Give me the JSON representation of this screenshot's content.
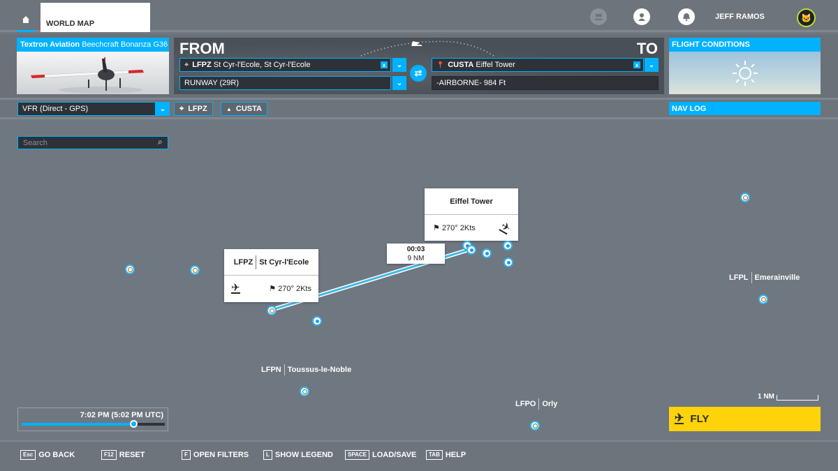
{
  "header": {
    "home_icon": "home-icon",
    "active_tab": "WORLD MAP",
    "icons": [
      "friends-icon",
      "profile-icon",
      "notifications-icon"
    ],
    "username": "JEFF RAMOS"
  },
  "aircraft": {
    "brand": "Textron Aviation",
    "model": "Beechcraft Bonanza G36"
  },
  "route": {
    "from_label": "FROM",
    "to_label": "TO",
    "from": {
      "icao": "LFPZ",
      "name": "St Cyr-l'Ecole, St Cyr-l'Ecole",
      "clear": "x"
    },
    "from_runway": "RUNWAY (29R)",
    "to": {
      "icao": "CUSTA",
      "name": "Eiffel Tower",
      "clear": "x"
    },
    "to_arrival": "-AIRBORNE- 984 Ft",
    "swap_icon": "swap-icon"
  },
  "conditions": {
    "title": "FLIGHT CONDITIONS",
    "weather_icon": "sun-icon"
  },
  "flight_plan": {
    "type": "VFR (Direct - GPS)",
    "departure_chip": "LFPZ",
    "arrival_chip": "CUSTA"
  },
  "nav_log": {
    "label": "NAV LOG"
  },
  "search": {
    "placeholder": "Search"
  },
  "map": {
    "departure_callout": {
      "icao": "LFPZ",
      "name": "St Cyr-l'Ecole",
      "wind": "270° 2Kts"
    },
    "arrival_callout": {
      "name": "Eiffel Tower",
      "wind": "270° 2Kts"
    },
    "leg": {
      "time": "00:03",
      "distance": "9 NM"
    },
    "airports": [
      {
        "icao": "LFPL",
        "name": "Emerainville"
      },
      {
        "icao": "LFPN",
        "name": "Toussus-le-Noble"
      },
      {
        "icao": "LFPO",
        "name": "Orly"
      }
    ],
    "scale": "1 NM"
  },
  "time": {
    "label": "7:02 PM (5:02 PM UTC)",
    "slider_percent": 78
  },
  "fly": {
    "label": "FLY"
  },
  "hints": [
    {
      "key": "Esc",
      "label": "GO BACK"
    },
    {
      "key": "F12",
      "label": "RESET"
    },
    {
      "key": "F",
      "label": "OPEN FILTERS"
    },
    {
      "key": "L",
      "label": "SHOW LEGEND"
    },
    {
      "key": "SPACE",
      "label": "LOAD/SAVE"
    },
    {
      "key": "TAB",
      "label": "HELP"
    }
  ]
}
